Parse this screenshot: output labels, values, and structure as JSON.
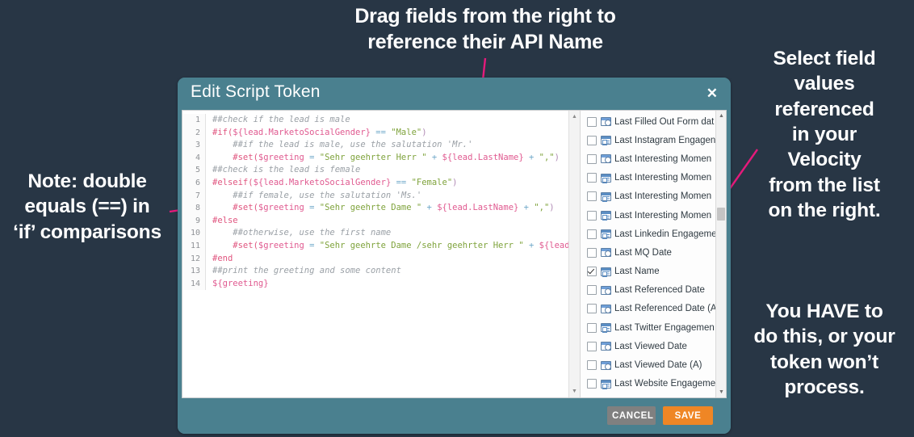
{
  "annotations": {
    "top": "Drag fields from the right to\nreference their API Name",
    "left": "Note: double\nequals (==) in\n‘if’ comparisons",
    "right_1": "Select field\nvalues\nreferenced\nin your\nVelocity\nfrom the list\non the right.",
    "right_2": "You HAVE to\ndo this, or your\ntoken won’t\nprocess.",
    "arrow_color": "#e51a7b"
  },
  "dialog": {
    "title": "Edit Script Token",
    "close_label": "✕",
    "header_color": "#4a808f",
    "footer": {
      "cancel_label": "CANCEL",
      "save_label": "SAVE",
      "cancel_color": "#808080",
      "save_color": "#ef8625"
    }
  },
  "editor": {
    "lines": [
      {
        "n": "1",
        "segments": [
          {
            "t": "##check if the lead is male",
            "c": "cmt"
          }
        ]
      },
      {
        "n": "2",
        "segments": [
          {
            "t": "#if(",
            "c": "dir"
          },
          {
            "t": "${lead.MarketoSocialGender}",
            "c": "var"
          },
          {
            "t": " == ",
            "c": "op"
          },
          {
            "t": "\"Male\"",
            "c": "str"
          },
          {
            "t": ")",
            "c": "par"
          }
        ]
      },
      {
        "n": "3",
        "segments": [
          {
            "t": "    ##if the lead is male, use the salutation 'Mr.'",
            "c": "cmt"
          }
        ]
      },
      {
        "n": "4",
        "segments": [
          {
            "t": "    #set(",
            "c": "dir"
          },
          {
            "t": "$greeting",
            "c": "var"
          },
          {
            "t": " = ",
            "c": "op"
          },
          {
            "t": "\"Sehr geehrter Herr \"",
            "c": "str"
          },
          {
            "t": " + ",
            "c": "op"
          },
          {
            "t": "${lead.LastName}",
            "c": "var"
          },
          {
            "t": " + ",
            "c": "op"
          },
          {
            "t": "\",\"",
            "c": "str"
          },
          {
            "t": ")",
            "c": "par"
          }
        ]
      },
      {
        "n": "5",
        "segments": [
          {
            "t": "##check is the lead is female",
            "c": "cmt"
          }
        ]
      },
      {
        "n": "6",
        "segments": [
          {
            "t": "#elseif(",
            "c": "dir"
          },
          {
            "t": "${lead.MarketoSocialGender}",
            "c": "var"
          },
          {
            "t": " == ",
            "c": "op"
          },
          {
            "t": "\"Female\"",
            "c": "str"
          },
          {
            "t": ")",
            "c": "par"
          }
        ]
      },
      {
        "n": "7",
        "segments": [
          {
            "t": "    ##if female, use the salutation 'Ms.'",
            "c": "cmt"
          }
        ]
      },
      {
        "n": "8",
        "segments": [
          {
            "t": "    #set(",
            "c": "dir"
          },
          {
            "t": "$greeting",
            "c": "var"
          },
          {
            "t": " = ",
            "c": "op"
          },
          {
            "t": "\"Sehr geehrte Dame \"",
            "c": "str"
          },
          {
            "t": " + ",
            "c": "op"
          },
          {
            "t": "${lead.LastName}",
            "c": "var"
          },
          {
            "t": " + ",
            "c": "op"
          },
          {
            "t": "\",\"",
            "c": "str"
          },
          {
            "t": ")",
            "c": "par"
          }
        ]
      },
      {
        "n": "9",
        "segments": [
          {
            "t": "#else",
            "c": "dir"
          }
        ]
      },
      {
        "n": "10",
        "segments": [
          {
            "t": "    ##otherwise, use the first name",
            "c": "cmt"
          }
        ]
      },
      {
        "n": "11",
        "segments": [
          {
            "t": "    #set(",
            "c": "dir"
          },
          {
            "t": "$greeting",
            "c": "var"
          },
          {
            "t": " = ",
            "c": "op"
          },
          {
            "t": "\"Sehr geehrte Dame /sehr geehrter Herr \"",
            "c": "str"
          },
          {
            "t": " + ",
            "c": "op"
          },
          {
            "t": "${lead.LastNa",
            "c": "var"
          }
        ]
      },
      {
        "n": "12",
        "segments": [
          {
            "t": "#end",
            "c": "dir"
          }
        ]
      },
      {
        "n": "13",
        "segments": [
          {
            "t": "##print the greeting and some content",
            "c": "cmt"
          }
        ]
      },
      {
        "n": "14",
        "segments": [
          {
            "t": "${greeting}",
            "c": "var"
          }
        ]
      }
    ]
  },
  "field_list": {
    "items": [
      {
        "label": "Last Filled Out Form dat",
        "icon": "date-field-icon",
        "checked": false
      },
      {
        "label": "Last Instagram Engagen",
        "icon": "text-field-icon",
        "checked": false
      },
      {
        "label": "Last Interesting Momen",
        "icon": "date-field-icon",
        "checked": false
      },
      {
        "label": "Last Interesting Momen",
        "icon": "text-field-icon",
        "checked": false
      },
      {
        "label": "Last Interesting Momen",
        "icon": "text-field-icon",
        "checked": false
      },
      {
        "label": "Last Interesting Momen",
        "icon": "text-field-icon",
        "checked": false
      },
      {
        "label": "Last Linkedin Engageme",
        "icon": "text-field-icon",
        "checked": false
      },
      {
        "label": "Last MQ Date",
        "icon": "date-field-icon",
        "checked": false
      },
      {
        "label": "Last Name",
        "icon": "text-field-icon",
        "checked": true
      },
      {
        "label": "Last Referenced Date",
        "icon": "date-field-icon",
        "checked": false
      },
      {
        "label": "Last Referenced Date (A",
        "icon": "date-field-icon",
        "checked": false
      },
      {
        "label": "Last Twitter Engagemen",
        "icon": "text-field-icon",
        "checked": false
      },
      {
        "label": "Last Viewed Date",
        "icon": "date-field-icon",
        "checked": false
      },
      {
        "label": "Last Viewed Date (A)",
        "icon": "date-field-icon",
        "checked": false
      },
      {
        "label": "Last Website Engageme",
        "icon": "text-field-icon",
        "checked": false
      }
    ]
  },
  "scroll": {
    "up_glyph": "▲",
    "down_glyph": "▼",
    "left_glyph": "◀",
    "right_glyph": "▶"
  }
}
